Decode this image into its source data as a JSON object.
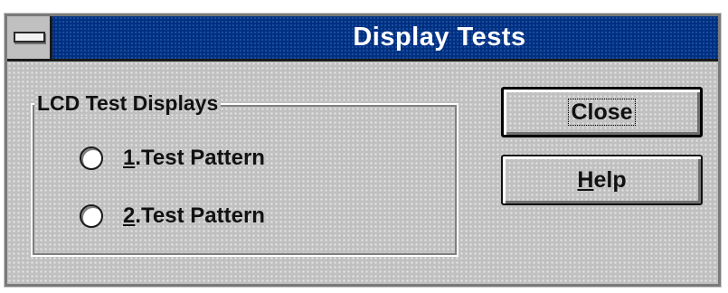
{
  "window": {
    "title": "Display Tests"
  },
  "group": {
    "label": "LCD Test Displays",
    "options": [
      {
        "mnemonic": "1",
        "rest": ".Test Pattern",
        "selected": false
      },
      {
        "mnemonic": "2",
        "rest": ".Test Pattern",
        "selected": false
      }
    ]
  },
  "buttons": {
    "close_label": "Close",
    "help_mnemonic": "H",
    "help_rest": "elp"
  },
  "icons": {
    "system_menu": "system-menu-icon"
  },
  "colors": {
    "titlebar": "#002f80",
    "face": "#c0c0c0",
    "title_text": "#ffffff"
  }
}
